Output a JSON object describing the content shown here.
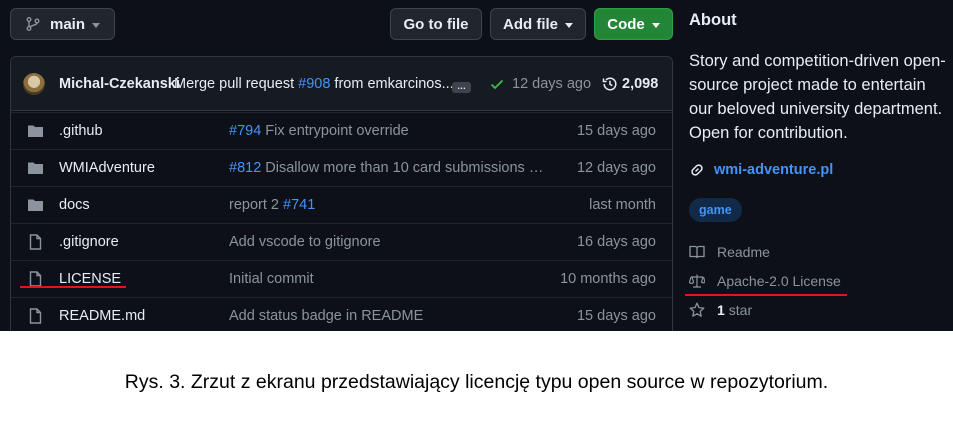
{
  "toolbar": {
    "branch_label": "main",
    "goto_label": "Go to file",
    "addfile_label": "Add file",
    "code_label": "Code"
  },
  "commit": {
    "author": "Michal-Czekanski",
    "message_prefix": "Merge pull request",
    "pr_link": "#908",
    "message_suffix": "from emkarcinos...",
    "ellipsis": "…",
    "time": "12 days ago",
    "count": "2,098"
  },
  "files": [
    {
      "type": "folder",
      "name": ".github",
      "msg_link": "#794",
      "msg": "Fix entrypoint override",
      "date": "15 days ago"
    },
    {
      "type": "folder",
      "name": "WMIAdventure",
      "msg_link": "#812",
      "msg": "Disallow more than 10 card submissions a ...",
      "date": "12 days ago"
    },
    {
      "type": "folder",
      "name": "docs",
      "msg_link": "",
      "msg": "report 2",
      "msg_link_after": "#741",
      "date": "last month"
    },
    {
      "type": "file",
      "name": ".gitignore",
      "msg_link": "",
      "msg": "Add vscode to gitignore",
      "date": "16 days ago"
    },
    {
      "type": "file",
      "name": "LICENSE",
      "msg_link": "",
      "msg": "Initial commit",
      "date": "10 months ago"
    },
    {
      "type": "file",
      "name": "README.md",
      "msg_link": "",
      "msg": "Add status badge in README",
      "date": "15 days ago"
    }
  ],
  "about": {
    "title": "About",
    "description": "Story and competition-driven open-source project made to entertain our beloved university department. Open for contribution.",
    "website": "wmi-adventure.pl",
    "topic": "game",
    "readme_label": "Readme",
    "license_label": "Apache-2.0 License",
    "stars_count": "1",
    "stars_label": "star"
  },
  "caption": "Rys. 3. Zrzut z ekranu przedstawiający licencję typu open source w repozytorium.",
  "colors": {
    "background": "#0d1117",
    "link": "#4493f8",
    "code_button": "#238636",
    "highlight_underline": "#e5141a"
  }
}
